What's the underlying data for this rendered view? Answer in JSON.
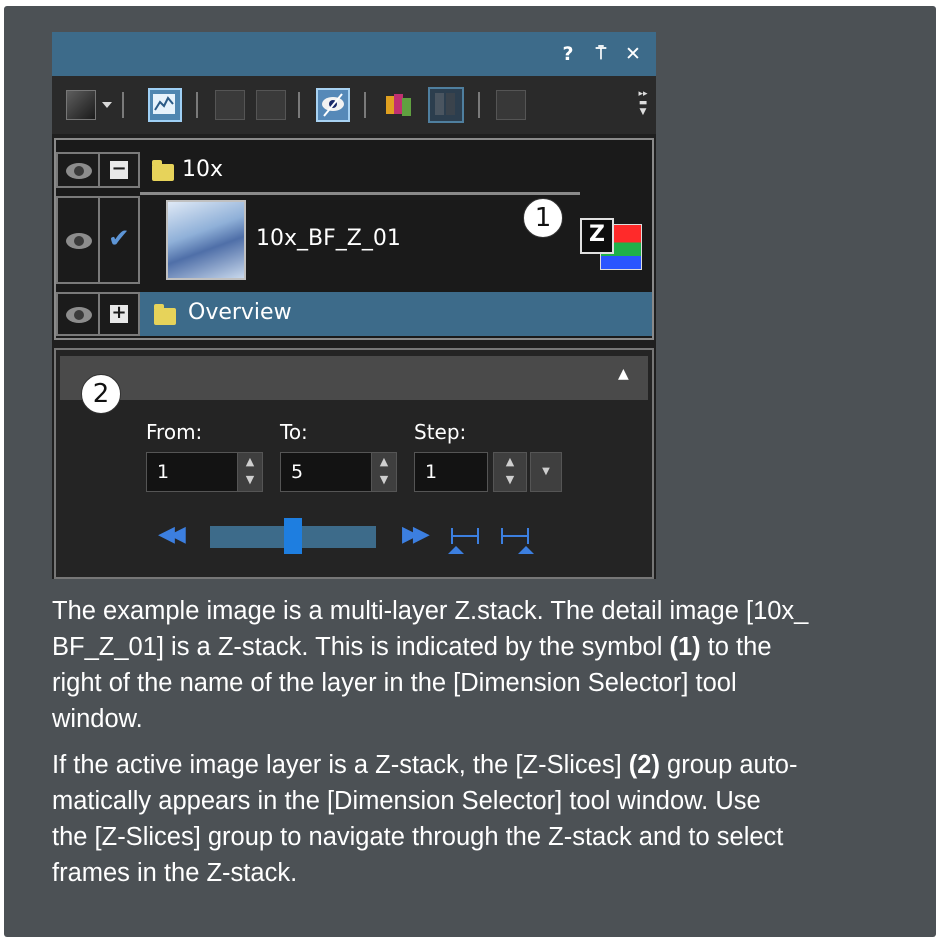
{
  "window": {
    "title_buttons": {
      "help": "?",
      "pin": "⍑",
      "close": "✕"
    },
    "toolbar": {
      "icons": [
        "image-color-icon",
        "dropdown-arrow-icon",
        "histogram-view-icon",
        "layer-up-icon",
        "layer-down-icon",
        "visibility-icon",
        "channels-icon",
        "split-view-icon",
        "delete-layer-icon",
        "overflow-icon"
      ]
    },
    "accent_color": "#3d6b8a"
  },
  "layers": [
    {
      "name": "10x",
      "type": "folder",
      "expanded": true,
      "toggle": "−"
    },
    {
      "name": "10x_BF_Z_01",
      "type": "image",
      "checked": true,
      "checkmark": "✔",
      "is_zstack": true,
      "zstack_symbol": "Z"
    },
    {
      "name": "Overview",
      "type": "folder",
      "expanded": false,
      "toggle": "+",
      "selected": true
    }
  ],
  "callouts": {
    "one": "1",
    "two": "2"
  },
  "zslices": {
    "collapse_icon": "▲",
    "from_label": "From:",
    "to_label": "To:",
    "step_label": "Step:",
    "from_value": "1",
    "to_value": "5",
    "step_value": "1",
    "slider_position": 0.5
  },
  "text": {
    "p1_a": "The example image is a multi-layer Z.stack. The detail image [10x_",
    "p1_b": "BF_Z_01] is a Z-stack. This is indicated by the symbol ",
    "p1_c": "(1)",
    "p1_d": " to the",
    "p1_e": "right of the name of the layer in the [Dimension Selector] tool",
    "p1_f": "window.",
    "p2_a": "If the active image layer is a Z-stack, the [Z-Slices] ",
    "p2_b": "(2)",
    "p2_c": " group auto-",
    "p2_d": "matically appears in the [Dimension Selector] tool window. Use",
    "p2_e": "the [Z-Slices] group to navigate through the Z-stack and to select",
    "p2_f": "frames in the Z-stack."
  }
}
